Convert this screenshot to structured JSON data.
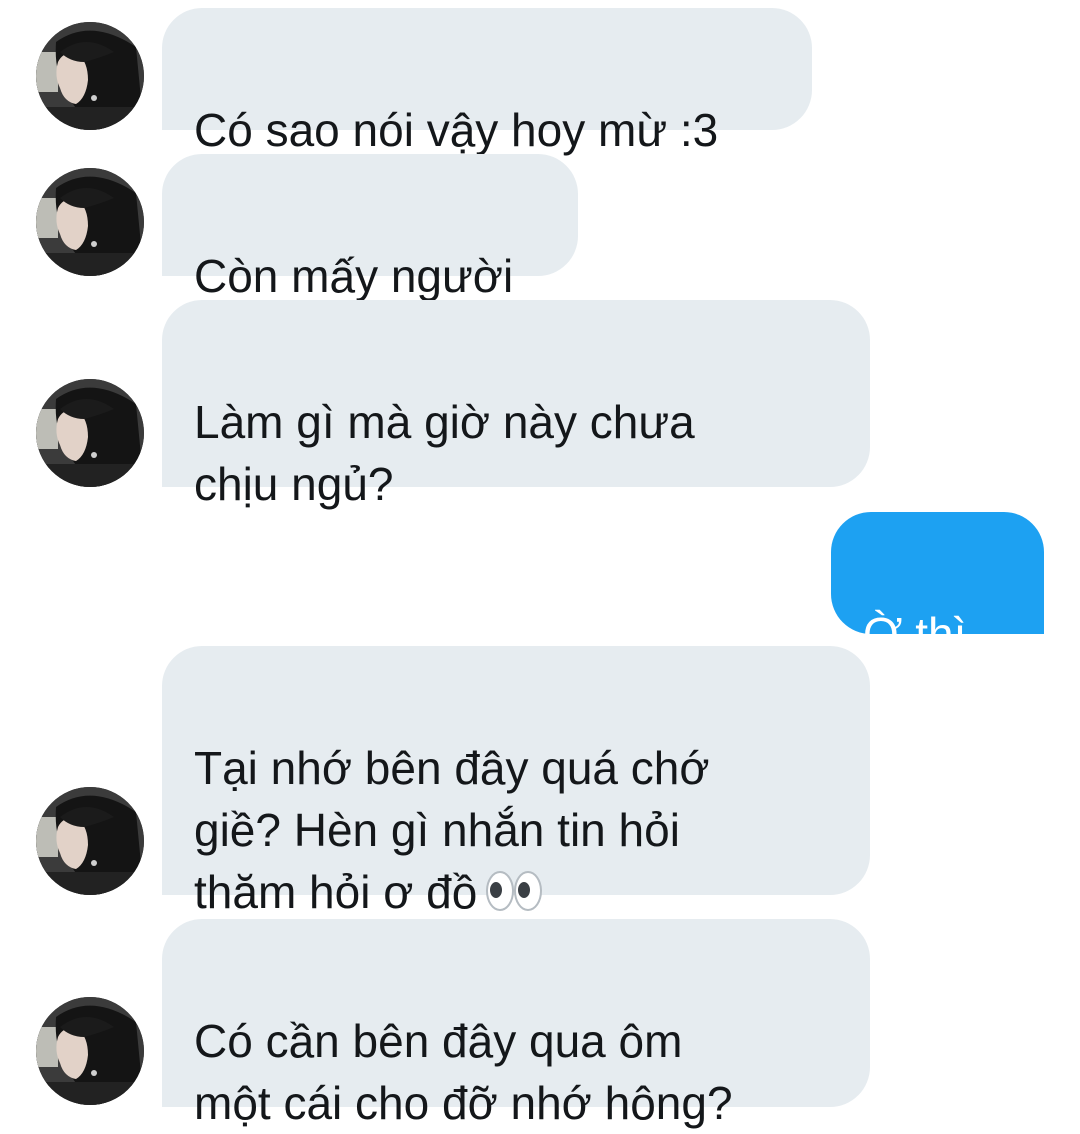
{
  "conversation": {
    "messages": [
      {
        "sender": "them",
        "text": "Có sao nói vậy hoy mừ :3"
      },
      {
        "sender": "them",
        "text": "Còn mấy người"
      },
      {
        "sender": "them",
        "text": "Làm gì mà giờ này chưa\nchịu ngủ?"
      },
      {
        "sender": "me",
        "text": "Ờ thì..."
      },
      {
        "sender": "them",
        "text": "Tại nhớ bên đây quá chớ\ngiề? Hèn gì nhắn tin hỏi\nthăm hỏi ơ đồ",
        "emoji": "eyes-icon"
      },
      {
        "sender": "them",
        "text": "Có cần bên đây qua ôm\nmột cái cho đỡ nhớ hông?"
      }
    ]
  },
  "colors": {
    "incoming_bubble": "#e6ecf0",
    "outgoing_bubble": "#1da1f2",
    "incoming_text": "#14171a",
    "outgoing_text": "#ffffff"
  }
}
